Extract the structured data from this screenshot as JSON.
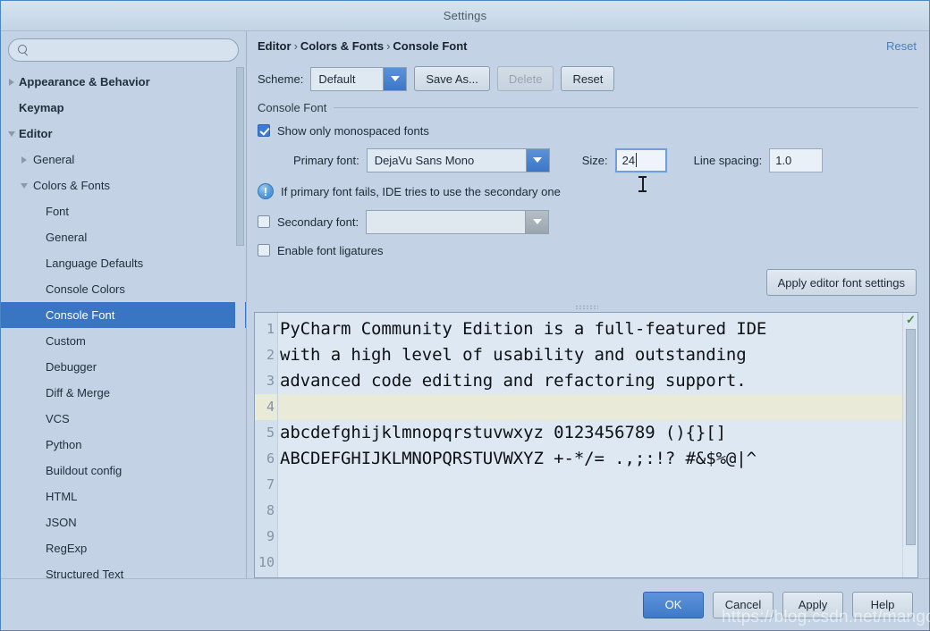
{
  "window": {
    "title": "Settings"
  },
  "search": {
    "value": "",
    "placeholder": "",
    "icon": "search-icon"
  },
  "sidebar": {
    "items": [
      {
        "label": "Appearance & Behavior",
        "level": 0,
        "arrow": "closed",
        "selected": false
      },
      {
        "label": "Keymap",
        "level": 0,
        "arrow": "none",
        "selected": false
      },
      {
        "label": "Editor",
        "level": 0,
        "arrow": "open",
        "selected": false
      },
      {
        "label": "General",
        "level": 1,
        "arrow": "closed",
        "selected": false
      },
      {
        "label": "Colors & Fonts",
        "level": 1,
        "arrow": "open",
        "selected": false
      },
      {
        "label": "Font",
        "level": 2,
        "arrow": "none",
        "selected": false
      },
      {
        "label": "General",
        "level": 2,
        "arrow": "none",
        "selected": false
      },
      {
        "label": "Language Defaults",
        "level": 2,
        "arrow": "none",
        "selected": false
      },
      {
        "label": "Console Colors",
        "level": 2,
        "arrow": "none",
        "selected": false
      },
      {
        "label": "Console Font",
        "level": 2,
        "arrow": "none",
        "selected": true
      },
      {
        "label": "Custom",
        "level": 2,
        "arrow": "none",
        "selected": false
      },
      {
        "label": "Debugger",
        "level": 2,
        "arrow": "none",
        "selected": false
      },
      {
        "label": "Diff & Merge",
        "level": 2,
        "arrow": "none",
        "selected": false
      },
      {
        "label": "VCS",
        "level": 2,
        "arrow": "none",
        "selected": false
      },
      {
        "label": "Python",
        "level": 2,
        "arrow": "none",
        "selected": false
      },
      {
        "label": "Buildout config",
        "level": 2,
        "arrow": "none",
        "selected": false
      },
      {
        "label": "HTML",
        "level": 2,
        "arrow": "none",
        "selected": false
      },
      {
        "label": "JSON",
        "level": 2,
        "arrow": "none",
        "selected": false
      },
      {
        "label": "RegExp",
        "level": 2,
        "arrow": "none",
        "selected": false
      },
      {
        "label": "Structured Text",
        "level": 2,
        "arrow": "none",
        "selected": false
      }
    ]
  },
  "header": {
    "breadcrumb": [
      "Editor",
      "Colors & Fonts",
      "Console Font"
    ],
    "separator": "›",
    "reset_label": "Reset"
  },
  "scheme": {
    "label": "Scheme:",
    "value": "Default",
    "save_as_label": "Save As...",
    "delete_label": "Delete",
    "reset_label": "Reset"
  },
  "group": {
    "title": "Console Font"
  },
  "form": {
    "show_monospaced_label": "Show only monospaced fonts",
    "show_monospaced_checked": true,
    "primary_font_label": "Primary font:",
    "primary_font_value": "DejaVu Sans Mono",
    "size_label": "Size:",
    "size_value": "24",
    "line_spacing_label": "Line spacing:",
    "line_spacing_value": "1.0",
    "info_text": "If primary font fails, IDE tries to use the secondary one",
    "info_icon": "info-icon",
    "secondary_font_label": "Secondary font:",
    "secondary_font_value": "",
    "secondary_font_checked": false,
    "ligatures_label": "Enable font ligatures",
    "ligatures_checked": false,
    "apply_editor_font_label": "Apply editor font settings"
  },
  "preview": {
    "line_numbers": [
      "1",
      "2",
      "3",
      "4",
      "5",
      "6",
      "7",
      "8",
      "9",
      "10"
    ],
    "lines": [
      "PyCharm Community Edition is a full-featured IDE",
      "with a high level of usability and outstanding",
      "advanced code editing and refactoring support.",
      "",
      "abcdefghijklmnopqrstuvwxyz 0123456789 (){}[]",
      "ABCDEFGHIJKLMNOPQRSTUVWXYZ +-*/= .,;:!? #&$%@|^",
      "",
      "",
      "",
      ""
    ],
    "caret_line_index": 3,
    "status_icon": "checkmark-icon",
    "status_glyph": "✓"
  },
  "footer": {
    "ok_label": "OK",
    "cancel_label": "Cancel",
    "apply_label": "Apply",
    "help_label": "Help"
  },
  "watermark": {
    "text": "https://blog.csdn.net/mango_kid"
  },
  "colors": {
    "accent": "#3a75c4",
    "panel": "#c3d3e5",
    "editor_bg": "#dde8f3",
    "caret_line": "#e9ebd8",
    "link": "#4a7ebb"
  }
}
